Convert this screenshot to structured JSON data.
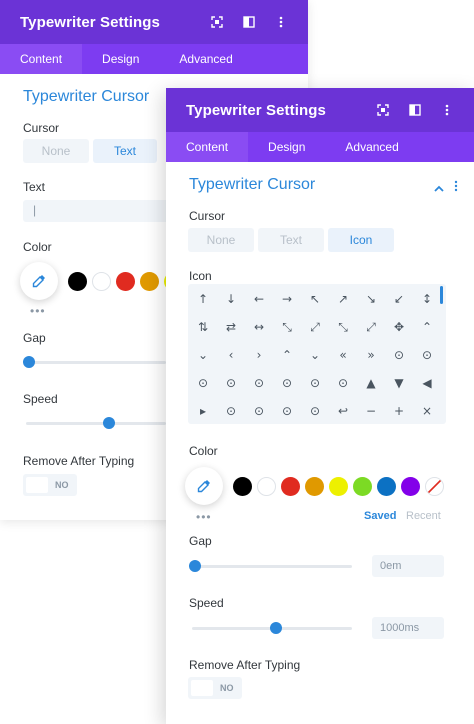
{
  "back_panel": {
    "title": "Typewriter Settings",
    "tabs": [
      "Content",
      "Design",
      "Advanced"
    ],
    "section_title": "Typewriter Cursor",
    "cursor_label": "Cursor",
    "cursor_options": [
      "None",
      "Text"
    ],
    "text_label": "Text",
    "text_value": "|",
    "color_label": "Color",
    "gap_label": "Gap",
    "speed_label": "Speed",
    "remove_label": "Remove After Typing",
    "toggle_label": "NO"
  },
  "front_panel": {
    "title": "Typewriter Settings",
    "tabs": [
      "Content",
      "Design",
      "Advanced"
    ],
    "section_title": "Typewriter Cursor",
    "cursor_label": "Cursor",
    "cursor_options": [
      "None",
      "Text",
      "Icon"
    ],
    "icon_label": "Icon",
    "icons": [
      "↑",
      "↓",
      "←",
      "→",
      "↖",
      "↗",
      "↘",
      "↙",
      "↕",
      "⇅",
      "⇄",
      "↔",
      "⤡",
      "⤢",
      "⤡",
      "⤢",
      "✥",
      "⌃",
      "⌄",
      "‹",
      "›",
      "⌃",
      "⌄",
      "«",
      "»",
      "⊙",
      "⊙",
      "⊙",
      "⊙",
      "⊙",
      "⊙",
      "⊙",
      "⊙",
      "▲",
      "▼",
      "◀",
      "▸",
      "⊙",
      "⊙",
      "⊙",
      "⊙",
      "↩",
      "−",
      "+",
      "×"
    ],
    "color_label": "Color",
    "saved_tab": "Saved",
    "recent_tab": "Recent",
    "gap_label": "Gap",
    "gap_value": "0em",
    "speed_label": "Speed",
    "speed_value": "1000ms",
    "remove_label": "Remove After Typing",
    "toggle_label": "NO"
  },
  "swatch_colors": [
    "#000000",
    "#ffffff",
    "#e02b20",
    "#e09900",
    "#edf000",
    "#7cda24",
    "#0c71c3",
    "#8300e9"
  ],
  "accent_color": "#2b87da",
  "header_color": "#6b33d6",
  "tab_bar_color": "#7d3cf1",
  "values": {
    "back_gap_fraction": 0.0,
    "back_speed_fraction": 0.5,
    "front_gap_fraction": 0.0,
    "front_speed_fraction": 0.5
  }
}
